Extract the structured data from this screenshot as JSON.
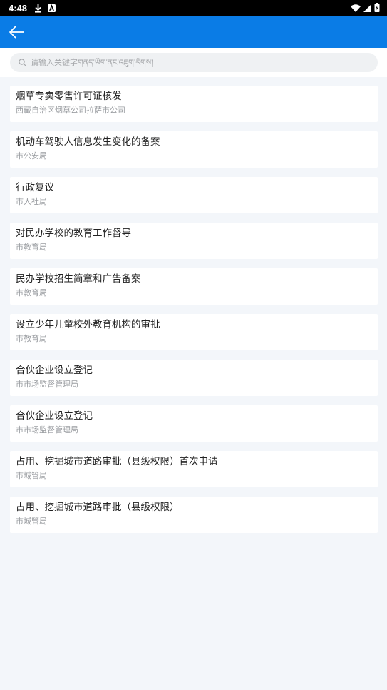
{
  "status_bar": {
    "time": "4:48"
  },
  "search": {
    "placeholder": "请输入关键字གནད་ཡིག་ནང་འཇུག་རོགས།"
  },
  "items": [
    {
      "title": "烟草专卖零售许可证核发",
      "dept": "西藏自治区烟草公司拉萨市公司"
    },
    {
      "title": "机动车驾驶人信息发生变化的备案",
      "dept": "市公安局"
    },
    {
      "title": "行政复议",
      "dept": "市人社局"
    },
    {
      "title": "对民办学校的教育工作督导",
      "dept": "市教育局"
    },
    {
      "title": "民办学校招生简章和广告备案",
      "dept": "市教育局"
    },
    {
      "title": "设立少年儿童校外教育机构的审批",
      "dept": "市教育局"
    },
    {
      "title": "合伙企业设立登记",
      "dept": "市市场监督管理局"
    },
    {
      "title": "合伙企业设立登记",
      "dept": "市市场监督管理局"
    },
    {
      "title": "占用、挖掘城市道路审批（县级权限）首次申请",
      "dept": "市城管局"
    },
    {
      "title": "占用、挖掘城市道路审批（县级权限）",
      "dept": "市城管局"
    }
  ],
  "colors": {
    "app_bar": "#0a7ce6",
    "background": "#f3f6fa",
    "card": "#ffffff"
  }
}
